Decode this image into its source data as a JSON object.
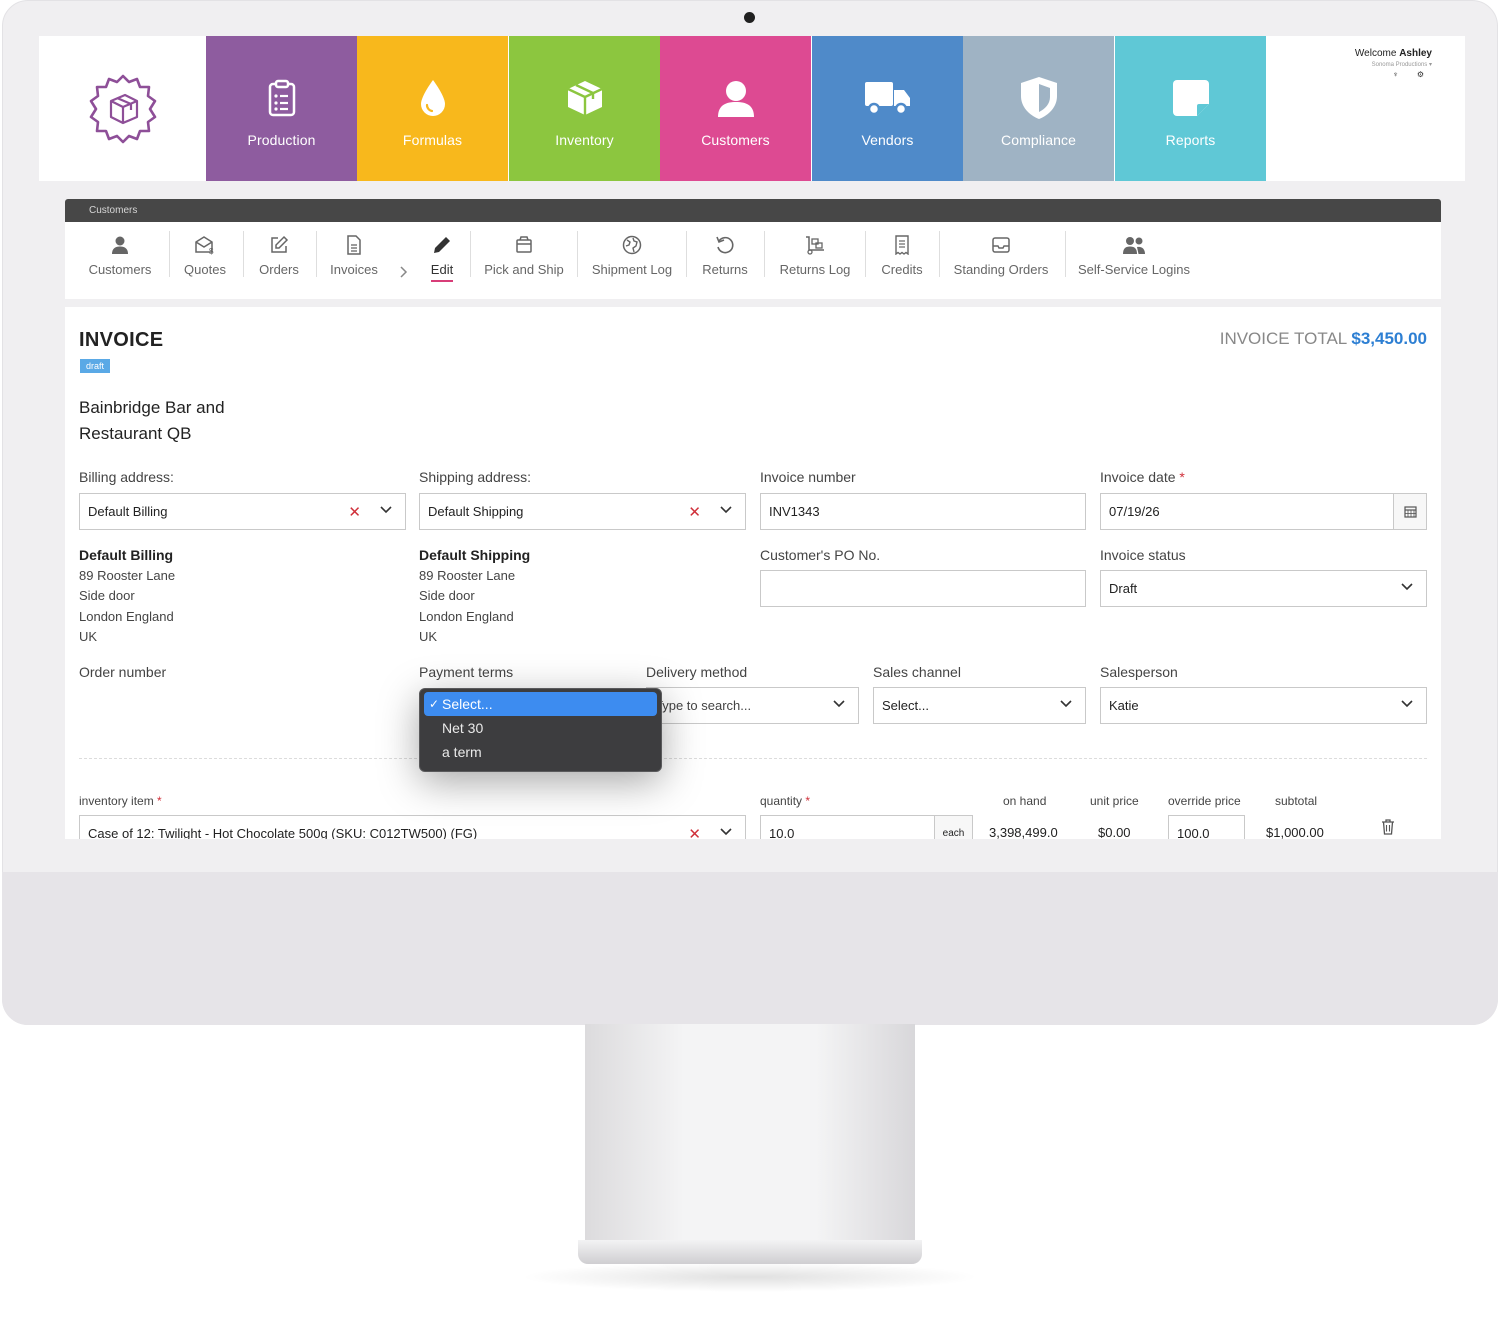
{
  "header": {
    "welcome_prefix": "Welcome",
    "user_name": "Ashley",
    "company": "Sonoma Productions ▾",
    "icons": "♆ ⚙"
  },
  "modules": [
    {
      "label": "Production",
      "color": "#8e5c9f",
      "icon": "clipboard-icon"
    },
    {
      "label": "Formulas",
      "color": "#f8b81c",
      "icon": "droplet-icon"
    },
    {
      "label": "Inventory",
      "color": "#8cc63f",
      "icon": "box-icon"
    },
    {
      "label": "Customers",
      "color": "#dd4a92",
      "icon": "person-icon"
    },
    {
      "label": "Vendors",
      "color": "#4f8ac9",
      "icon": "truck-icon"
    },
    {
      "label": "Compliance",
      "color": "#9fb3c4",
      "icon": "shield-icon"
    },
    {
      "label": "Reports",
      "color": "#5fc8d6",
      "icon": "note-icon"
    }
  ],
  "breadcrumb": "Customers",
  "subnav": [
    {
      "label": "Customers"
    },
    {
      "label": "Quotes"
    },
    {
      "label": "Orders"
    },
    {
      "label": "Invoices"
    },
    {
      "label": "Edit"
    },
    {
      "label": "Pick and Ship"
    },
    {
      "label": "Shipment Log"
    },
    {
      "label": "Returns"
    },
    {
      "label": "Returns Log"
    },
    {
      "label": "Credits"
    },
    {
      "label": "Standing Orders"
    },
    {
      "label": "Self-Service Logins"
    }
  ],
  "invoice": {
    "title": "INVOICE",
    "status_badge": "draft",
    "total_label": "INVOICE TOTAL",
    "total_value": "$3,450.00",
    "customer_line1": "Bainbridge Bar and",
    "customer_line2": "Restaurant QB"
  },
  "form": {
    "billing_label": "Billing address:",
    "billing_value": "Default Billing",
    "shipping_label": "Shipping address:",
    "shipping_value": "Default Shipping",
    "invoice_number_label": "Invoice number",
    "invoice_number_value": "INV1343",
    "invoice_date_label": "Invoice date",
    "invoice_date_value": "07/19/26",
    "po_label": "Customer's PO No.",
    "po_value": "",
    "status_label": "Invoice status",
    "status_value": "Draft",
    "order_number_label": "Order number",
    "payment_terms_label": "Payment terms",
    "delivery_label": "Delivery method",
    "delivery_placeholder": "Type to search...",
    "sales_channel_label": "Sales channel",
    "sales_channel_value": "Select...",
    "salesperson_label": "Salesperson",
    "salesperson_value": "Katie",
    "required_mark": "*"
  },
  "billing_address": {
    "heading": "Default Billing",
    "line1": "89 Rooster Lane",
    "line2": "Side door",
    "line3": "London England",
    "line4": "UK"
  },
  "shipping_address": {
    "heading": "Default Shipping",
    "line1": "89 Rooster Lane",
    "line2": "Side door",
    "line3": "London England",
    "line4": "UK"
  },
  "payment_terms_dropdown": {
    "options": [
      "Select...",
      "Net 30",
      "a term"
    ],
    "selected": "✓"
  },
  "line_item": {
    "item_label": "inventory item",
    "item_value": "Case of 12: Twilight - Hot Chocolate 500g (SKU: C012TW500) (FG)",
    "quantity_label": "quantity",
    "quantity_value": "10.0",
    "unit": "each",
    "on_hand_label": "on hand",
    "on_hand_value": "3,398,499.0",
    "unit_price_label": "unit price",
    "unit_price_value": "$0.00",
    "override_label": "override price",
    "override_value": "100.0",
    "subtotal_label": "subtotal",
    "subtotal_value": "$1,000.00"
  }
}
